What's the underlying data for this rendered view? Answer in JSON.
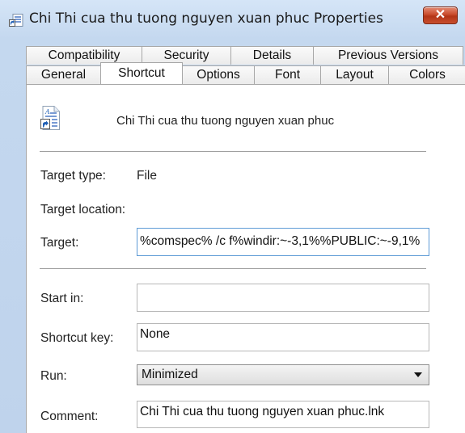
{
  "window": {
    "title": "Chi Thi cua thu tuong nguyen xuan phuc Properties",
    "close_icon": "close-x-icon",
    "close_color": "#c94b2c"
  },
  "tabs": {
    "row_top": [
      "Compatibility",
      "Security",
      "Details",
      "Previous Versions"
    ],
    "row_bottom": [
      "General",
      "Shortcut",
      "Options",
      "Font",
      "Layout",
      "Colors"
    ],
    "active": "Shortcut"
  },
  "header": {
    "file_name": "Chi Thi cua thu tuong nguyen xuan phuc",
    "icon": "shortcut-document-icon"
  },
  "fields": {
    "target_type_label": "Target type:",
    "target_type_value": "File",
    "target_location_label": "Target location:",
    "target_label": "Target:",
    "target_value": "%comspec% /c f%windir:~-3,1%%PUBLIC:~-9,1%",
    "start_in_label": "Start in:",
    "start_in_value": "",
    "shortcut_key_label": "Shortcut key:",
    "shortcut_key_value": "None",
    "run_label": "Run:",
    "run_value": "Minimized",
    "comment_label": "Comment:",
    "comment_value": "Chi Thi cua thu tuong nguyen xuan phuc.lnk"
  }
}
